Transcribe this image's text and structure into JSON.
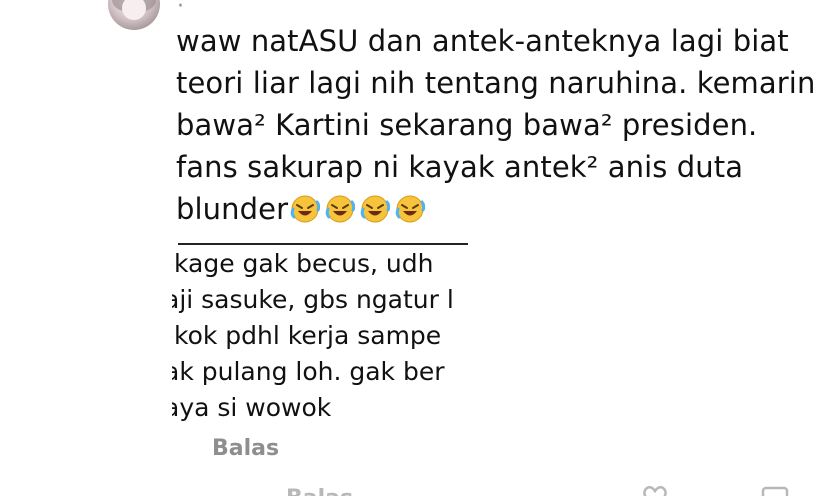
{
  "comment": {
    "author_marker": "·",
    "lines": [
      "waw natASU dan antek-anteknya lagi biat",
      "teori liar lagi nih tentang naruhina. kemarin",
      "bawa² Kartini sekarang bawa² presiden.",
      "fans sakurap ni kayak antek² anis duta",
      "blunder"
    ],
    "emoji_name": "rolling-on-the-floor-laughing"
  },
  "embedded_screenshot": {
    "lines": [
      "›kage gak becus, udh",
      "aji sasuke, gbs ngatur l",
      "›kok pdhl kerja sampe",
      "ak pulang loh. gak ber",
      "aya si wowok"
    ]
  },
  "actions": {
    "reply_label": "Balas"
  },
  "next_row": {
    "partial_label": "Balas"
  }
}
